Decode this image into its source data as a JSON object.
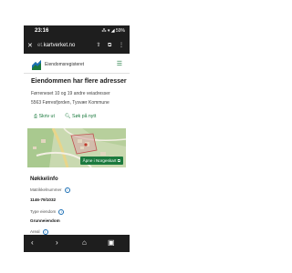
{
  "status": {
    "time": "23:16",
    "icons": "⁂ ▾ ◢ 59%"
  },
  "browser": {
    "url_prefix": "et.",
    "url_main": "kartverket.no",
    "close_icon": "close-icon",
    "icons": "⇧ ⧉ ⋮"
  },
  "site": {
    "name": "Eiendomsregisteret",
    "menu_icon": "☰"
  },
  "page": {
    "title": "Eiendommen har flere adresser",
    "address_line1": "Førreneset 10 og 19 andre veiadresser",
    "address_line2": "5563 Førresfjorden, Tysvær Kommune"
  },
  "actions": {
    "print_label": "⎙ Skriv ut",
    "search_label": "🔍︎ Søk på nytt"
  },
  "map": {
    "open_label": "Åpne i Norgeskart ⧉"
  },
  "info": {
    "section_title": "Nøkkelinfo",
    "f1_label": "Matrikkelnummer",
    "f1_value": "1146-79/1032",
    "f2_label": "Type eiendom",
    "f2_value": "Grunneiendom",
    "f3_label": "Areal"
  },
  "nav": {
    "back": "‹",
    "forward": "›",
    "home": "⌂",
    "tabs": "▣"
  },
  "colors": {
    "accent": "#1b7a3e",
    "dark": "#1e1e1e",
    "info_blue": "#1b6fb5"
  }
}
